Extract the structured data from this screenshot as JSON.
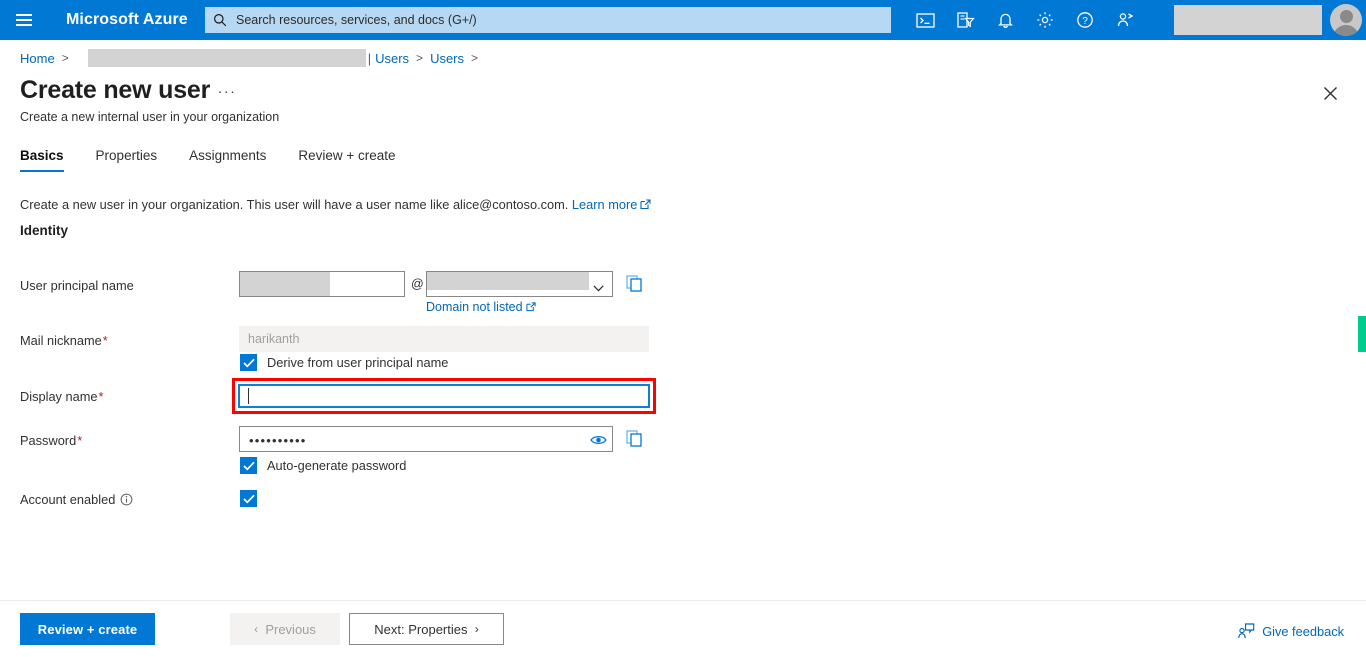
{
  "header": {
    "brand": "Microsoft Azure",
    "menu_icon": "hamburger-icon",
    "search": {
      "placeholder": "Search resources, services, and docs (G+/)",
      "value": "",
      "icon": "search-icon"
    },
    "icons": [
      {
        "name": "cloud-shell-icon",
        "label": "Cloud Shell"
      },
      {
        "name": "directory-subscription-filter-icon",
        "label": "Directories + subscriptions"
      },
      {
        "name": "notifications-bell-icon",
        "label": "Notifications"
      },
      {
        "name": "settings-gear-icon",
        "label": "Settings"
      },
      {
        "name": "help-question-icon",
        "label": "Help"
      },
      {
        "name": "feedback-person-icon",
        "label": "Feedback"
      }
    ],
    "tenant_redacted": true,
    "avatar": "user-avatar"
  },
  "breadcrumb": {
    "home": "Home",
    "redacted": true,
    "items": [
      "Users",
      "Users"
    ],
    "separator": ">"
  },
  "blade": {
    "title": "Create new user",
    "more_actions": "···",
    "subtitle": "Create a new internal user in your organization",
    "close_icon": "close-icon"
  },
  "tabs": [
    {
      "label": "Basics",
      "active": true
    },
    {
      "label": "Properties",
      "active": false
    },
    {
      "label": "Assignments",
      "active": false
    },
    {
      "label": "Review + create",
      "active": false
    }
  ],
  "main": {
    "description": "Create a new user in your organization. This user will have a user name like alice@contoso.com.",
    "learn_more": "Learn more",
    "section_identity": "Identity",
    "fields": {
      "upn": {
        "label": "User principal name",
        "value": "",
        "redacted": true,
        "at_sign": "@",
        "domain_value": "",
        "domain_redacted": true,
        "domain_not_listed_link": "Domain not listed",
        "copy_icon": "copy-icon"
      },
      "mail_nickname": {
        "label": "Mail nickname",
        "required": "*",
        "value": "harikanth",
        "disabled": true,
        "checkbox": {
          "label": "Derive from user principal name",
          "checked": true
        }
      },
      "display_name": {
        "label": "Display name",
        "required": "*",
        "value": "",
        "focused": true,
        "highlighted": true
      },
      "password": {
        "label": "Password",
        "required": "*",
        "value": "••••••••••",
        "reveal_icon": "eye-icon",
        "copy_icon": "copy-icon",
        "checkbox": {
          "label": "Auto-generate password",
          "checked": true
        }
      },
      "account_enabled": {
        "label": "Account enabled",
        "info_icon": "info-icon",
        "checked": true
      }
    }
  },
  "footer": {
    "review_create": "Review + create",
    "previous": "Previous",
    "previous_disabled": true,
    "next": "Next: Properties",
    "give_feedback": "Give feedback"
  },
  "colors": {
    "azure_blue": "#0078d4",
    "link_blue": "#0067b8",
    "highlight_red": "#ff0000",
    "required_red": "#a4262c",
    "green_edge": "#00cc8e"
  }
}
